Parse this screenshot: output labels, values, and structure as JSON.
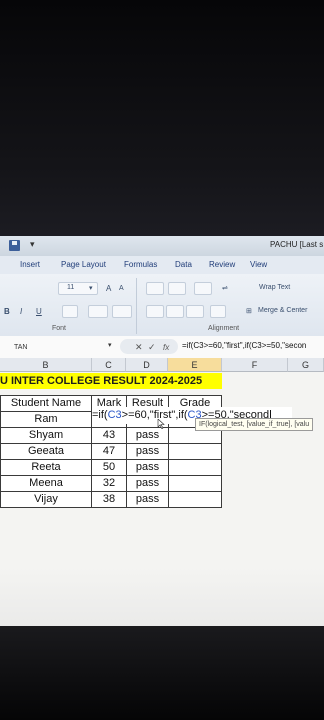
{
  "window": {
    "title": "PACHU [Last s"
  },
  "tabs": [
    "Insert",
    "Page Layout",
    "Formulas",
    "Data",
    "Review",
    "View"
  ],
  "ribbon": {
    "font_size": "11",
    "grow_font": "A",
    "shrink_font": "A",
    "bold": "B",
    "italic": "I",
    "underline": "U",
    "wrap_text": "Wrap Text",
    "merge_center": "Merge & Center",
    "font_group": "Font",
    "alignment_group": "Alignment"
  },
  "formula_bar": {
    "name_box": "TAN",
    "cancel": "✕",
    "enter": "✓",
    "fx": "fx",
    "formula": "=if(C3>=60,\"first\",if(C3>=50,\"secon"
  },
  "columns": [
    "B",
    "C",
    "D",
    "E",
    "F",
    "G"
  ],
  "sheet": {
    "banner": "U INTER COLLEGE RESULT 2024-2025",
    "headers": [
      "Student Name",
      "Mark",
      "Result",
      "Grade"
    ],
    "rows": [
      {
        "name": "Ram",
        "mark": "",
        "result": "",
        "grade": ""
      },
      {
        "name": "Shyam",
        "mark": "43",
        "result": "pass",
        "grade": ""
      },
      {
        "name": "Geeata",
        "mark": "47",
        "result": "pass",
        "grade": ""
      },
      {
        "name": "Reeta",
        "mark": "50",
        "result": "pass",
        "grade": ""
      },
      {
        "name": "Meena",
        "mark": "32",
        "result": "pass",
        "grade": ""
      },
      {
        "name": "Vijay",
        "mark": "38",
        "result": "pass",
        "grade": ""
      }
    ],
    "editing": {
      "p1": "=if(",
      "ref1": "C3",
      "p2": ">=60,\"first\",if(",
      "ref2": "C3",
      "p3": ">=50,\"second"
    },
    "tooltip": "IF(logical_test, [value_if_true], [valu"
  }
}
